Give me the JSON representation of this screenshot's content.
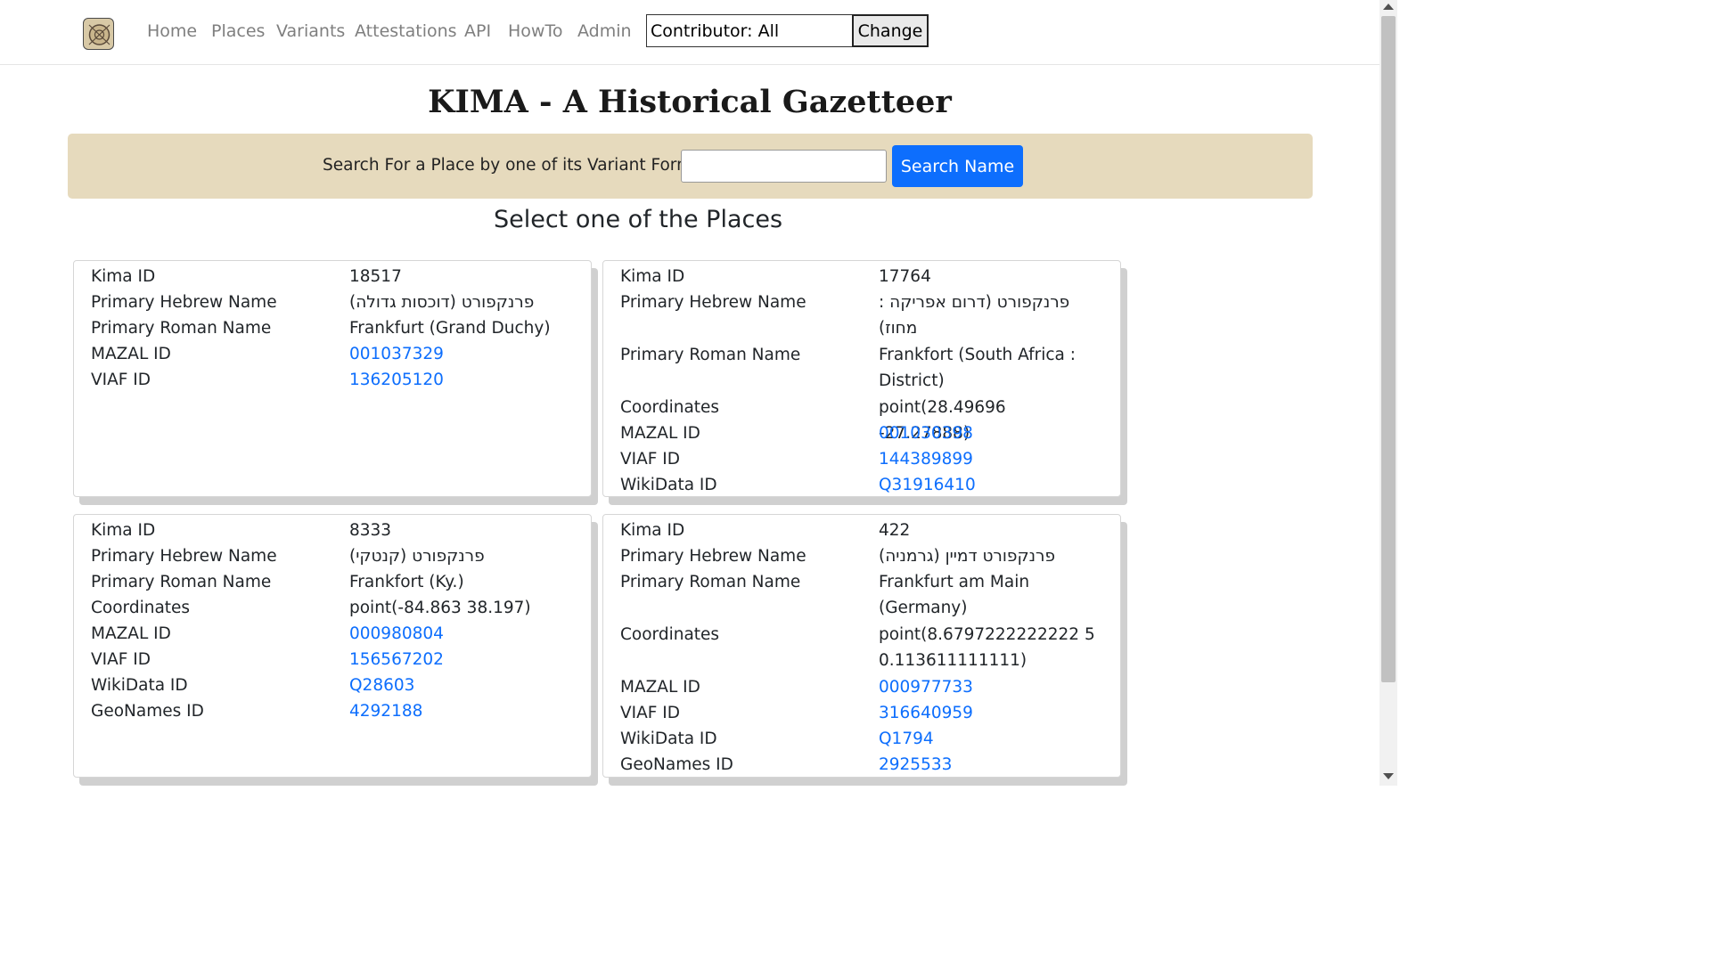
{
  "nav": {
    "links": [
      "Home",
      "Places",
      "Variants",
      "Attestations",
      "API",
      "HowTo",
      "Admin"
    ],
    "contributor_value": "Contributor: All",
    "change_label": "Change"
  },
  "page_title": "KIMA - A Historical Gazetteer",
  "search": {
    "label": "Search For a Place by one of its Variant Forms:",
    "value": "",
    "button_label": "Search Name"
  },
  "section_title": "Select one of the Places",
  "places": [
    {
      "rows": [
        {
          "label": "Kima ID",
          "value": "18517"
        },
        {
          "label": "Primary Hebrew Name",
          "value": "פרנקפורט (דוכסות גדולה)"
        },
        {
          "label": "Primary Roman Name",
          "value": "Frankfurt (Grand Duchy)"
        },
        {
          "label": "MAZAL ID",
          "value": "001037329"
        },
        {
          "label": "VIAF ID",
          "value": "136205120"
        }
      ]
    },
    {
      "rows": [
        {
          "label": "Kima ID",
          "value": "17764"
        },
        {
          "label": "Primary Hebrew Name",
          "value": "פרנקפורט (דרום אפריקה : מחוז)"
        },
        {
          "label": "Primary Roman Name",
          "value": "Frankfort (South Africa : District)"
        },
        {
          "label": "Coordinates",
          "value": "point(28.49696 -27.27888)"
        },
        {
          "label": "MAZAL ID",
          "value": "001030398"
        },
        {
          "label": "VIAF ID",
          "value": "144389899"
        },
        {
          "label": "WikiData ID",
          "value": "Q31916410"
        }
      ]
    },
    {
      "rows": [
        {
          "label": "Kima ID",
          "value": "8333"
        },
        {
          "label": "Primary Hebrew Name",
          "value": "פרנקפורט (קנטקי)"
        },
        {
          "label": "Primary Roman Name",
          "value": "Frankfort (Ky.)"
        },
        {
          "label": "Coordinates",
          "value": "point(-84.863 38.197)"
        },
        {
          "label": "MAZAL ID",
          "value": "000980804"
        },
        {
          "label": "VIAF ID",
          "value": "156567202"
        },
        {
          "label": "WikiData ID",
          "value": "Q28603"
        },
        {
          "label": "GeoNames ID",
          "value": "4292188"
        }
      ]
    },
    {
      "rows": [
        {
          "label": "Kima ID",
          "value": "422"
        },
        {
          "label": "Primary Hebrew Name",
          "value": "פרנקפורט דמיין (גרמניה)"
        },
        {
          "label": "Primary Roman Name",
          "value": "Frankfurt am Main (Germany)"
        },
        {
          "label": "Coordinates",
          "value": "point(8.6797222222222 50.113611111111)"
        },
        {
          "label": "MAZAL ID",
          "value": "000977733"
        },
        {
          "label": "VIAF ID",
          "value": "316640959"
        },
        {
          "label": "WikiData ID",
          "value": "Q1794"
        },
        {
          "label": "GeoNames ID",
          "value": "2925533"
        }
      ]
    }
  ]
}
